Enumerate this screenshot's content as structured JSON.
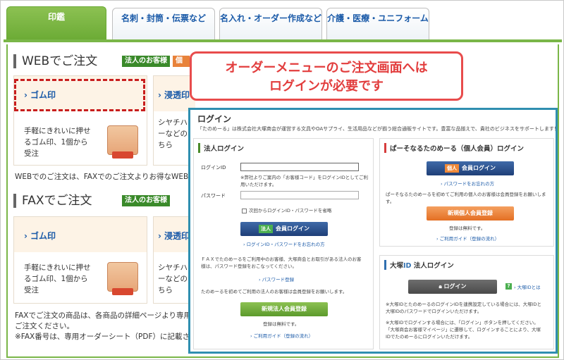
{
  "tabs": [
    {
      "label": "印鑑",
      "active": true
    },
    {
      "label": "名刺・封筒・伝票など",
      "active": false
    },
    {
      "label": "名入れ・オーダー作成など",
      "active": false
    },
    {
      "label": "介護・医療・ユニフォーム",
      "active": false
    }
  ],
  "web_section": {
    "title": "WEBでご注文",
    "badge_corporate": "法人のお客様",
    "badge_personal": "個人"
  },
  "web_cards": [
    {
      "link": "ゴム印",
      "desc_lines": [
        "手軽にきれいに押せ",
        "るゴム印、1個から",
        "受注"
      ]
    },
    {
      "link": "浸透印",
      "desc_lines": [
        "シヤチハ",
        "ーなどの",
        "ちら"
      ]
    }
  ],
  "web_note": "WEBでのご注文は、FAXでのご注文よりお得なWEB価",
  "fax_section": {
    "title": "FAXでご注文",
    "badge_corporate": "法人のお客様"
  },
  "fax_cards": [
    {
      "link": "ゴム印",
      "desc_lines": [
        "手軽にきれいに押せ",
        "るゴム印、1個から",
        "受注"
      ]
    },
    {
      "link": "浸透印",
      "desc_lines": [
        "シヤチハ",
        "ーなどの",
        "ちら"
      ]
    }
  ],
  "fax_note_lines": [
    "FAXでご注文の商品は、各商品の詳細ページより専用オ",
    "ご注文ください。",
    "※FAX番号は、専用オーダーシート（PDF）に記載され"
  ],
  "callout": {
    "line1": "オーダーメニューのご注文画面へは",
    "line2": "ログインが必要です"
  },
  "login": {
    "title": "ログイン",
    "intro": "「たのめーる」は株式会社大塚商会が運営する文具やOAサプライ、生活用品などが揃う総合通販サイトです。豊富な品揃えで、貴社のビジネスをサポートします！",
    "corporate": {
      "heading": "法人ログイン",
      "id_label": "ログインID",
      "id_note_lines": [
        "※弊社よりご案内の「お客様コード」をログインIDとしてご利",
        "用いただけます。"
      ],
      "password_label": "パスワード",
      "remember_label": "次回からログインID・パスワードを省略",
      "login_tag": "法人",
      "login_button": "会員ログイン",
      "forgot_link": "ログインID・パスワードをお忘れの方",
      "fax_note_lines": [
        "ＦＡＸでたのめーるをご利用中のお客様、大塚商会とお取引がある法人のお客",
        "様は、パスワード登録をおこなってください。"
      ],
      "password_register_link": "パスワード登録",
      "first_time_note": "たのめーるを初めてご利用の法人のお客様は会員登録をお願いします。",
      "register_button": "新規法人会員登録",
      "free_note": "登録は無料です。",
      "guide_link": "ご利用ガイド（登録の流れ）"
    },
    "personal": {
      "heading": "ぱーそなるたのめーる（個人会員）ログイン",
      "login_tag": "個人",
      "login_button": "会員ログイン",
      "forgot_link": "パスワードをお忘れの方",
      "first_time_note": "ぱーそなるたのめーるを初めてご利用の個人のお客様は会員登録をお願いします。",
      "register_button": "新規個人会員登録",
      "free_note": "登録は無料です。",
      "guide_link": "ご利用ガイド（登録の流れ）"
    },
    "otsuka": {
      "heading_prefix": "大塚",
      "heading_id": "ID",
      "heading_suffix": " 法人ログイン",
      "login_button": "ログイン",
      "id_link": "大塚IDとは",
      "note1_lines": [
        "※大塚IDとたのめーるのログインIDを連携設定している場合には、大塚IDと",
        "大塚IDのパスワードでログインいただけます。"
      ],
      "note2_lines": [
        "※大塚IDでログインする場合には、「ログイン」ボタンを押してください。",
        "「大塚商会お客様マイページ」に遷移して、ログインすることにより、大塚",
        "IDでたのめーるにログインいただけます。"
      ]
    }
  }
}
